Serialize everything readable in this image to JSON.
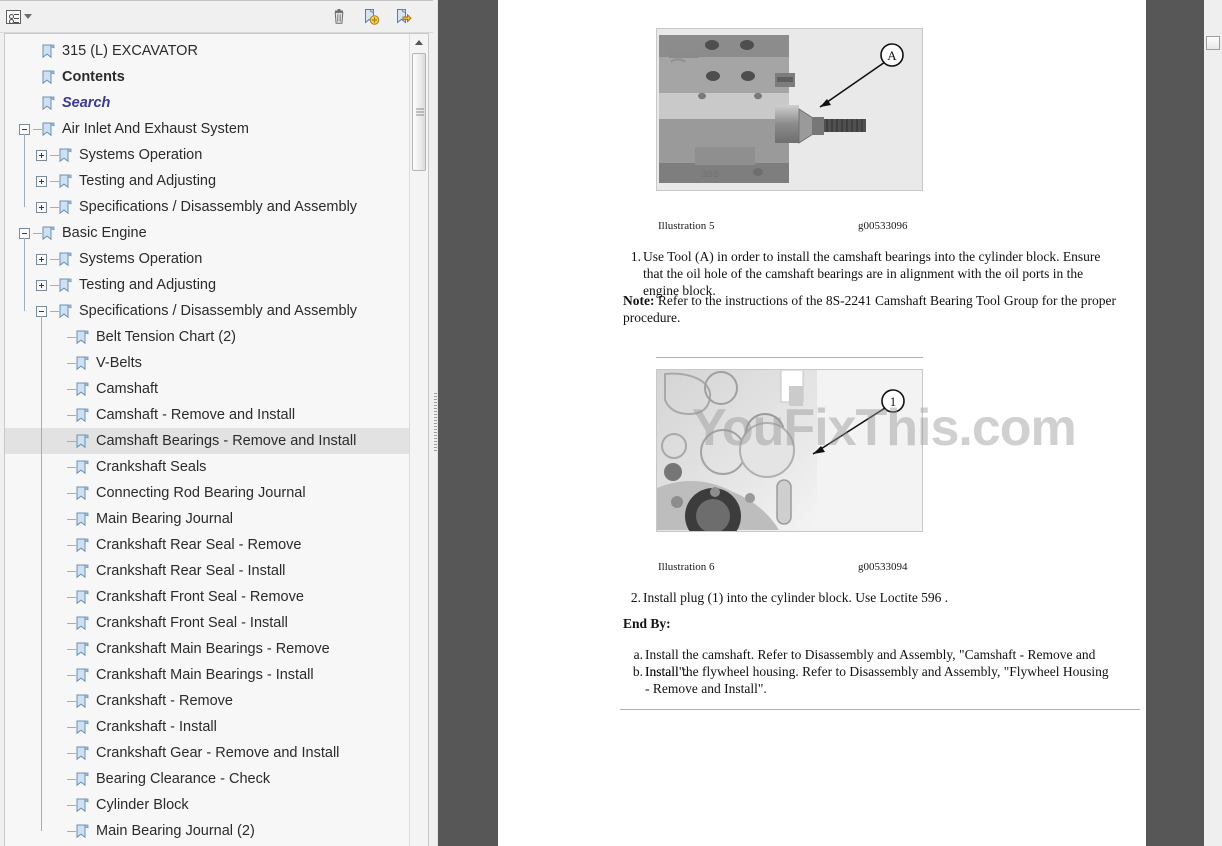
{
  "panel": {
    "toolbar": {
      "options_label": "Options",
      "icons": [
        {
          "name": "delete-bookmark-icon",
          "title": "Delete"
        },
        {
          "name": "new-bookmark-icon",
          "title": "New Bookmark"
        },
        {
          "name": "expand-bookmark-icon",
          "title": "Expand Current Bookmark"
        }
      ]
    },
    "tree": [
      {
        "label": "315 (L) EXCAVATOR",
        "depth": 0,
        "toggle": "none",
        "style": "normal"
      },
      {
        "label": "Contents",
        "depth": 0,
        "toggle": "none",
        "style": "bold"
      },
      {
        "label": "Search",
        "depth": 0,
        "toggle": "none",
        "style": "link"
      },
      {
        "label": "Air Inlet And Exhaust System",
        "depth": 0,
        "toggle": "minus",
        "style": "normal"
      },
      {
        "label": "Systems Operation",
        "depth": 1,
        "toggle": "plus",
        "style": "normal"
      },
      {
        "label": "Testing and Adjusting",
        "depth": 1,
        "toggle": "plus",
        "style": "normal"
      },
      {
        "label": "Specifications / Disassembly and Assembly",
        "depth": 1,
        "toggle": "plus",
        "style": "normal"
      },
      {
        "label": "Basic Engine",
        "depth": 0,
        "toggle": "minus",
        "style": "normal"
      },
      {
        "label": "Systems Operation",
        "depth": 1,
        "toggle": "plus",
        "style": "normal"
      },
      {
        "label": "Testing and Adjusting",
        "depth": 1,
        "toggle": "plus",
        "style": "normal"
      },
      {
        "label": "Specifications / Disassembly and Assembly",
        "depth": 1,
        "toggle": "minus",
        "style": "normal"
      },
      {
        "label": "Belt Tension Chart (2)",
        "depth": 2,
        "toggle": "none",
        "style": "normal"
      },
      {
        "label": "V-Belts",
        "depth": 2,
        "toggle": "none",
        "style": "normal"
      },
      {
        "label": "Camshaft",
        "depth": 2,
        "toggle": "none",
        "style": "normal"
      },
      {
        "label": "Camshaft - Remove and Install",
        "depth": 2,
        "toggle": "none",
        "style": "normal"
      },
      {
        "label": "Camshaft Bearings - Remove and Install",
        "depth": 2,
        "toggle": "none",
        "style": "normal",
        "selected": true
      },
      {
        "label": "Crankshaft Seals",
        "depth": 2,
        "toggle": "none",
        "style": "normal"
      },
      {
        "label": "Connecting Rod Bearing Journal",
        "depth": 2,
        "toggle": "none",
        "style": "normal"
      },
      {
        "label": "Main Bearing Journal",
        "depth": 2,
        "toggle": "none",
        "style": "normal"
      },
      {
        "label": "Crankshaft Rear Seal - Remove",
        "depth": 2,
        "toggle": "none",
        "style": "normal"
      },
      {
        "label": "Crankshaft Rear Seal - Install",
        "depth": 2,
        "toggle": "none",
        "style": "normal"
      },
      {
        "label": "Crankshaft Front Seal - Remove",
        "depth": 2,
        "toggle": "none",
        "style": "normal"
      },
      {
        "label": "Crankshaft Front Seal - Install",
        "depth": 2,
        "toggle": "none",
        "style": "normal"
      },
      {
        "label": "Crankshaft Main Bearings - Remove",
        "depth": 2,
        "toggle": "none",
        "style": "normal"
      },
      {
        "label": "Crankshaft Main Bearings - Install",
        "depth": 2,
        "toggle": "none",
        "style": "normal"
      },
      {
        "label": "Crankshaft - Remove",
        "depth": 2,
        "toggle": "none",
        "style": "normal"
      },
      {
        "label": "Crankshaft - Install",
        "depth": 2,
        "toggle": "none",
        "style": "normal"
      },
      {
        "label": "Crankshaft Gear - Remove and Install",
        "depth": 2,
        "toggle": "none",
        "style": "normal"
      },
      {
        "label": "Bearing Clearance - Check",
        "depth": 2,
        "toggle": "none",
        "style": "normal"
      },
      {
        "label": "Cylinder Block",
        "depth": 2,
        "toggle": "none",
        "style": "normal"
      },
      {
        "label": "Main Bearing Journal (2)",
        "depth": 2,
        "toggle": "none",
        "style": "normal"
      }
    ]
  },
  "document": {
    "watermark": "YouFixThis.com",
    "figures": [
      {
        "name": "illustration-5-photo",
        "callout": "A"
      },
      {
        "name": "illustration-6-photo",
        "callout": "1"
      }
    ],
    "captions": [
      {
        "number": "Illustration 5",
        "id": "g00533096"
      },
      {
        "number": "Illustration 6",
        "id": "g00533094"
      }
    ],
    "step1_marker": "1.",
    "step1_text": "Use Tool (A) in order to install the camshaft bearings into the cylinder block. Ensure that the oil hole of the camshaft bearings are in alignment with the oil ports in the engine block.",
    "note_label": "Note:",
    "note_text": " Refer to the instructions of the 8S-2241 Camshaft Bearing Tool Group for the proper procedure.",
    "step2_marker": "2.",
    "step2_text": "Install plug (1) into the cylinder block. Use Loctite 596 .",
    "end_by_heading": "End By:",
    "end_by_items": [
      {
        "marker": "a.",
        "text": "Install the camshaft. Refer to Disassembly and Assembly, \"Camshaft - Remove and Install\"."
      },
      {
        "marker": "b.",
        "text": "Install the flywheel housing. Refer to Disassembly and Assembly, \"Flywheel Housing - Remove and Install\"."
      }
    ]
  },
  "colors": {
    "doc_background": "#575757",
    "panel_background": "#f0f0f0",
    "tree_background": "#f7f7f7",
    "selection": "#e2e2e2",
    "link": "#3b3b8f"
  }
}
